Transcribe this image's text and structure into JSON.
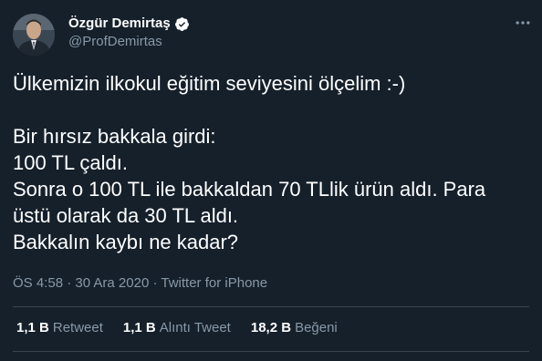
{
  "author": {
    "display_name": "Özgür Demirtaş",
    "handle": "@ProfDemirtas",
    "verified_icon": "verified-badge-icon",
    "avatar_icon": "avatar"
  },
  "tweet": {
    "lines": [
      "Ülkemizin ilkokul eğitim seviyesini ölçelim :-)",
      "",
      "Bir hırsız bakkala girdi:",
      "100 TL çaldı.",
      "Sonra o 100 TL ile bakkaldan 70 TLlik ürün aldı. Para",
      "üstü olarak da 30 TL aldı.",
      "Bakkalın kaybı ne kadar?"
    ]
  },
  "meta": {
    "time": "ÖS 4:58",
    "separator": "·",
    "date": "30 Ara 2020",
    "source": "Twitter for iPhone"
  },
  "stats": {
    "retweets_count": "1,1 B",
    "retweets_label": "Retweet",
    "quotes_count": "1,1 B",
    "quotes_label": "Alıntı Tweet",
    "likes_count": "18,2 B",
    "likes_label": "Beğeni"
  },
  "colors": {
    "background": "#15202b",
    "secondary_text": "#8899a6",
    "divider": "#38444d",
    "verified": "#ffffff"
  }
}
